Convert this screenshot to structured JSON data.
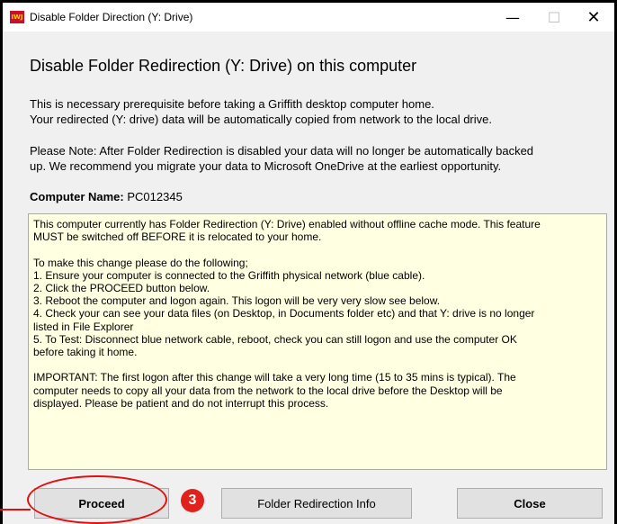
{
  "window": {
    "app_icon_text": "IWJ",
    "title": "Disable Folder Direction (Y: Drive)",
    "minimize_glyph": "—",
    "maximize_glyph": "☐",
    "close_glyph": "✕"
  },
  "main": {
    "heading": "Disable Folder Redirection (Y: Drive) on this computer",
    "paragraph1": "This is necessary prerequisite before taking a Griffith desktop computer home.\nYour redirected (Y: drive) data will be automatically copied from network to the local drive.",
    "paragraph2": "Please Note: After Folder Redirection is disabled your data will no longer be automatically backed\nup. We recommend you migrate your data to Microsoft OneDrive at the earliest opportunity.",
    "computer_name_label": "Computer Name:",
    "computer_name_value": " PC012345",
    "info_text": "This computer currently has Folder Redirection (Y: Drive) enabled without offline cache mode. This feature\nMUST be switched off BEFORE it is relocated to your home.\n\nTo make this change please do the following;\n1. Ensure your computer is connected to the Griffith physical network (blue cable).\n2. Click the PROCEED button below.\n3. Reboot the computer and logon again. This logon will be very very slow see below.\n4. Check your can see your data files (on Desktop, in Documents folder etc) and that Y: drive is no longer\nlisted in File Explorer\n5. To Test: Disconnect blue network cable, reboot, check you can still logon and use the computer OK\nbefore taking it home.\n\nIMPORTANT: The first logon after this change will take a very long time (15 to 35 mins is typical). The\ncomputer needs to copy all your data from the network to the local drive before the Desktop will be\ndisplayed. Please be patient and do not interrupt this process."
  },
  "buttons": {
    "proceed": "Proceed",
    "info": "Folder Redirection Info",
    "close": "Close"
  },
  "annotation": {
    "step_number": "3",
    "color": "#e01010"
  }
}
